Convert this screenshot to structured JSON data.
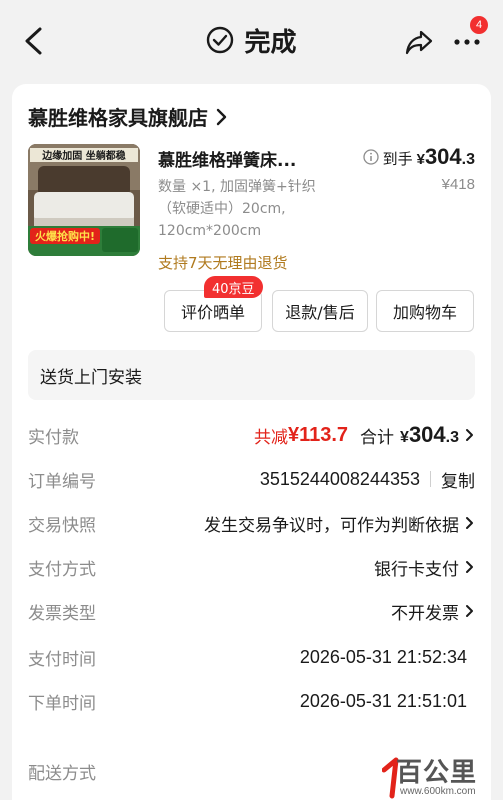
{
  "header": {
    "title": "完成",
    "notification_count": "4",
    "icons": {
      "back": "chevron-left-icon",
      "status": "check-circle-icon",
      "share": "share-icon",
      "more": "more-icon"
    }
  },
  "store": {
    "name": "慕胜维格家具旗舰店"
  },
  "product": {
    "title": "慕胜维格弹簧床...",
    "spec": "数量 ×1, 加固弹簧+针织（软硬适中）20cm, 120cm*200cm",
    "return_policy": "支持7天无理由退货",
    "price_label": "到手",
    "price_currency": "¥",
    "price_integer": "304",
    "price_decimal": ".3",
    "original_price": "¥418",
    "image_caption": "边缘加固 坐躺都稳",
    "image_sale_text": "火爆抢购中!"
  },
  "actions": {
    "review_label": "评价晒单",
    "review_badge": "40京豆",
    "refund_label": "退款/售后",
    "cart_label": "加购物车"
  },
  "install_service": "送货上门安装",
  "details": {
    "paid": {
      "label": "实付款",
      "discount_text": "共减",
      "discount_amount": "¥113.7",
      "total_text": "合计",
      "total_currency": "¥",
      "total_integer": "304",
      "total_decimal": ".3"
    },
    "order_no": {
      "label": "订单编号",
      "value": "3515244008244353",
      "copy_label": "复制"
    },
    "snapshot": {
      "label": "交易快照",
      "value": "发生交易争议时，可作为判断依据"
    },
    "payment": {
      "label": "支付方式",
      "value": "银行卡支付"
    },
    "invoice": {
      "label": "发票类型",
      "value": "不开发票"
    },
    "pay_time": {
      "label": "支付时间",
      "value": "2026-05-31 21:52:34"
    },
    "order_time": {
      "label": "下单时间",
      "value": "2026-05-31 21:51:01"
    },
    "delivery": {
      "label": "配送方式"
    }
  },
  "watermark": {
    "text": "百公里",
    "url": "www.600km.com"
  },
  "colors": {
    "accent_red": "#e2231a",
    "badge_red": "#f23030",
    "gold": "#b07a1e",
    "muted": "#8c8c8c"
  }
}
